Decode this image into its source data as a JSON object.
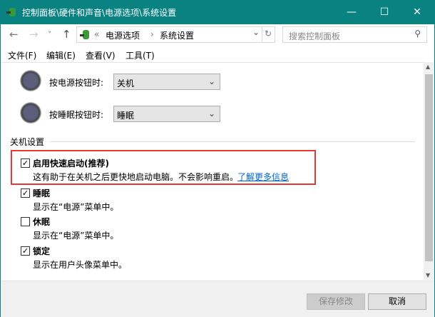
{
  "window": {
    "title": "控制面板\\硬件和声音\\电源选项\\系统设置",
    "minimize": "—",
    "maximize": "☐",
    "close": "✕"
  },
  "nav": {
    "back": "←",
    "forward": "→",
    "recent": "˅",
    "up": "↑",
    "chevrons": "«",
    "crumbs": [
      "电源选项",
      "系统设置"
    ],
    "sep": "›",
    "dropdown": "⌄",
    "refresh": "↻",
    "search_placeholder": "搜索控制面板",
    "search_icon": "⚲"
  },
  "menu": [
    "文件(F)",
    "编辑(E)",
    "查看(V)",
    "工具(T)"
  ],
  "buttons_section": {
    "power_label": "按电源按钮时:",
    "power_value": "关机",
    "sleep_label": "按睡眠按钮时:",
    "sleep_value": "睡眠",
    "chevron": "⌄"
  },
  "shutdown": {
    "heading": "关机设置",
    "items": [
      {
        "label": "启用快速启动(推荐)",
        "checked": true,
        "desc": "这有助于在关机之后更快地启动电脑。不会影响重启。",
        "link": "了解更多信息"
      },
      {
        "label": "睡眠",
        "checked": true,
        "desc": "显示在“电源”菜单中。"
      },
      {
        "label": "休眠",
        "checked": false,
        "desc": "显示在“电源”菜单中。"
      },
      {
        "label": "锁定",
        "checked": true,
        "desc": "显示在用户头像菜单中。"
      }
    ]
  },
  "footer": {
    "save": "保存修改",
    "cancel": "取消"
  },
  "colors": {
    "title": "#0b8282",
    "highlight": "#e53935",
    "link": "#0066cc"
  }
}
